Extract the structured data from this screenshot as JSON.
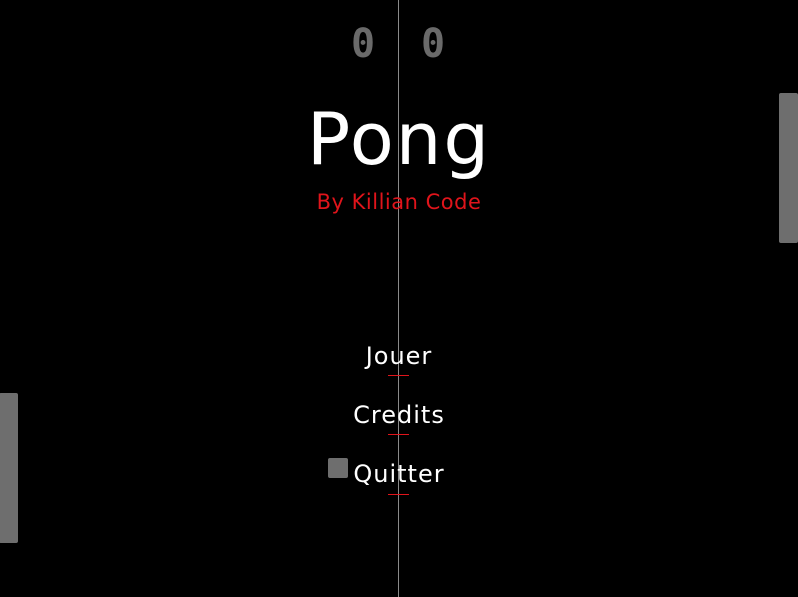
{
  "score": {
    "left": "0",
    "right": "0"
  },
  "title": "Pong",
  "subtitle": "By Killian Code",
  "menu": {
    "play": "Jouer",
    "credits": "Credits",
    "quit": "Quitter"
  },
  "colors": {
    "background": "#000000",
    "title": "#ffffff",
    "subtitle": "#e0141b",
    "accent": "#e0141b",
    "paddle": "#6e6e6e",
    "score": "#6a6a6a",
    "center_line": "#8a8a8a"
  }
}
